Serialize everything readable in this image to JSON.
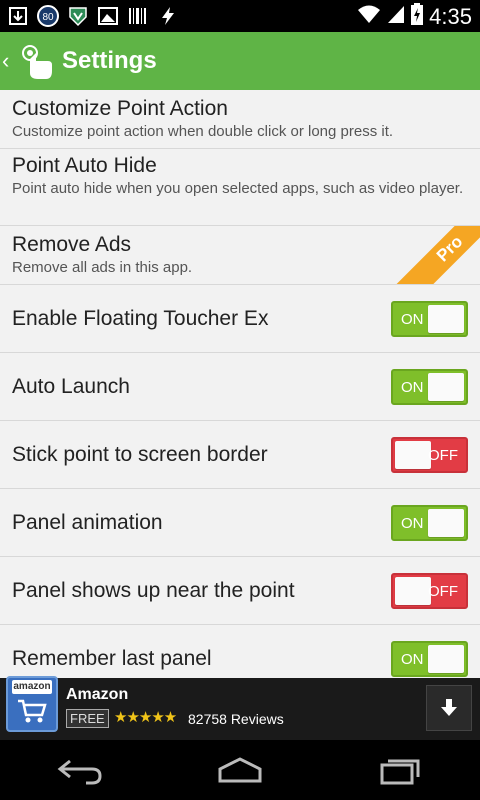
{
  "status_bar": {
    "time": "4:35",
    "left_icons": [
      "download-icon",
      "speed-80-icon",
      "shield-icon",
      "image-icon",
      "barcode-icon",
      "flash-icon"
    ],
    "speed_badge": "80",
    "right_icons": [
      "wifi-icon",
      "cell-signal-icon",
      "battery-icon"
    ]
  },
  "action_bar": {
    "title": "Settings",
    "color": "#5fb446"
  },
  "settings": {
    "customize": {
      "title": "Customize Point Action",
      "subtitle": "Customize point action when double click or long press it."
    },
    "auto_hide": {
      "title": "Point Auto Hide",
      "subtitle": "Point auto hide when you open selected apps, such as video player."
    },
    "remove_ads": {
      "title": "Remove Ads",
      "subtitle": "Remove all ads in this app.",
      "badge": "Pro"
    },
    "toggles": [
      {
        "title": "Enable Floating Toucher Ex",
        "state": "ON"
      },
      {
        "title": "Auto Launch",
        "state": "ON"
      },
      {
        "title": "Stick point to screen border",
        "state": "OFF"
      },
      {
        "title": "Panel animation",
        "state": "ON"
      },
      {
        "title": "Panel shows up near the point",
        "state": "OFF"
      },
      {
        "title": "Remember last panel",
        "state": "ON"
      }
    ]
  },
  "ad": {
    "icon_label": "amazon",
    "title": "Amazon",
    "price": "FREE",
    "stars": "★★★★★",
    "rating": 4.5,
    "reviews": "82758 Reviews"
  },
  "nav": {
    "buttons": [
      "back-icon",
      "home-icon",
      "recents-icon"
    ]
  },
  "colors": {
    "toggle_on": "#7fbf2a",
    "toggle_off": "#e23c45",
    "pro_ribbon": "#f5a623"
  }
}
